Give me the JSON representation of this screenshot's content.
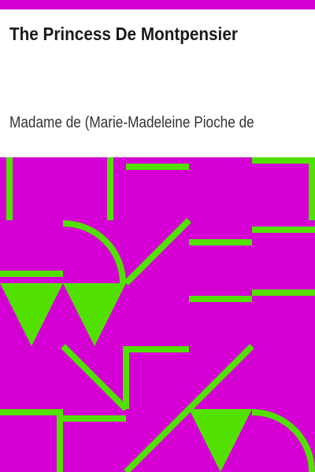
{
  "book": {
    "title": "The Princess De Montpensier",
    "author": "Madame de (Marie-Madeleine Pioche de"
  },
  "colors": {
    "band": "#d400d4",
    "art_background": "#d400d4",
    "art_foreground": "#52e000",
    "title_text": "#1a1a1a",
    "author_text": "#333333"
  }
}
